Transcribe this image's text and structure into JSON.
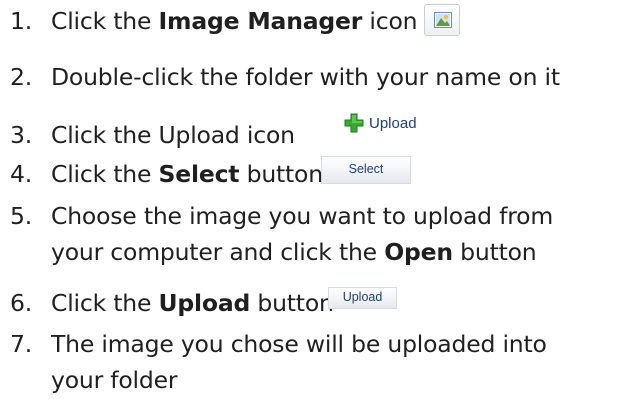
{
  "steps": [
    {
      "num": "1.",
      "pre": "Click the ",
      "bold": "Image Manager",
      "post": " icon"
    },
    {
      "num": "2.",
      "text": "Double-click the folder with your name on it"
    },
    {
      "num": "3.",
      "text": "Click the Upload icon"
    },
    {
      "num": "4.",
      "pre": "Click the ",
      "bold": "Select",
      "post": " button"
    },
    {
      "num": "5.",
      "text": "Choose the image you want to upload from",
      "cont_pre": "your computer and click the ",
      "cont_bold": "Open",
      "cont_post": " button"
    },
    {
      "num": "6.",
      "pre": "Click the ",
      "bold": "Upload",
      "post": " button"
    },
    {
      "num": "7.",
      "text": "The image you chose will be uploaded into",
      "cont": "your folder"
    }
  ],
  "inline_images": {
    "image_manager_icon": "image-manager-icon",
    "upload_icon_label": "Upload",
    "select_button_label": "Select",
    "upload_button_label": "Upload"
  },
  "colors": {
    "text": "#1f1f1f",
    "button_text": "#1e3f6e",
    "plus_green": "#3aa835"
  }
}
